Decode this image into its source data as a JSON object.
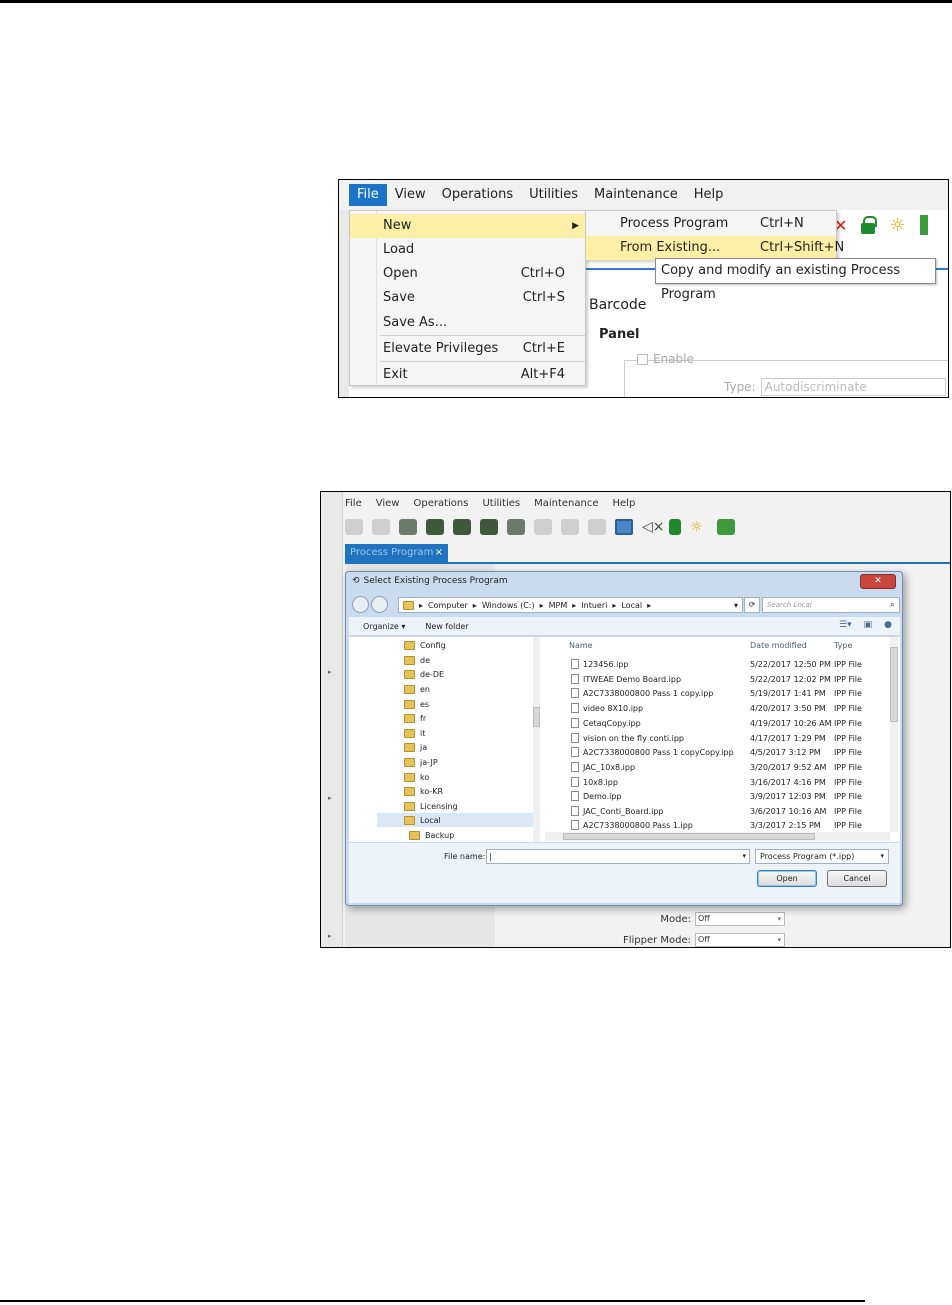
{
  "shot1": {
    "menubar": [
      "File",
      "View",
      "Operations",
      "Utilities",
      "Maintenance",
      "Help"
    ],
    "file_menu": {
      "items": [
        {
          "label": "New",
          "shortcut": ""
        },
        {
          "label": "Load",
          "shortcut": ""
        },
        {
          "label": "Open",
          "shortcut": "Ctrl+O"
        },
        {
          "label": "Save",
          "shortcut": "Ctrl+S"
        },
        {
          "label": "Save As...",
          "shortcut": ""
        },
        {
          "label": "Elevate Privileges",
          "shortcut": "Ctrl+E"
        },
        {
          "label": "Exit",
          "shortcut": "Alt+F4"
        }
      ]
    },
    "sub_menu": {
      "items": [
        {
          "label": "Process Program",
          "shortcut": "Ctrl+N"
        },
        {
          "label": "From Existing...",
          "shortcut": "Ctrl+Shift+N"
        }
      ]
    },
    "tooltip": "Copy and modify an existing Process Program",
    "background": {
      "barcode": "Barcode",
      "panel": "Panel",
      "enable": "Enable",
      "type_label": "Type:",
      "type_value": "Autodiscriminate"
    },
    "icons": [
      "close-red-icon",
      "lock-icon",
      "lightbulb-icon"
    ]
  },
  "shot2": {
    "menubar": [
      "File",
      "View",
      "Operations",
      "Utilities",
      "Maintenance",
      "Help"
    ],
    "tab_label": "Process Program",
    "tab_close": "×",
    "dialog": {
      "title": "Select Existing Process Program",
      "close": "✕",
      "breadcrumb": [
        "Computer",
        "Windows (C:)",
        "MPM",
        "Intueri",
        "Local"
      ],
      "search_placeholder": "Search Local",
      "organize": "Organize ▾",
      "new_folder": "New folder",
      "tree": [
        "Config",
        "de",
        "de-DE",
        "en",
        "es",
        "fr",
        "it",
        "ja",
        "ja-JP",
        "ko",
        "ko-KR",
        "Licensing",
        "Local",
        "Backup"
      ],
      "columns": {
        "name": "Name",
        "date": "Date modified",
        "type": "Type"
      },
      "files": [
        {
          "name": "123456.ipp",
          "date": "5/22/2017 12:50 PM",
          "type": "IPP File"
        },
        {
          "name": "ITWEAE Demo Board.ipp",
          "date": "5/22/2017 12:02 PM",
          "type": "IPP File"
        },
        {
          "name": "A2C7338000800 Pass 1 copy.ipp",
          "date": "5/19/2017 1:41 PM",
          "type": "IPP File"
        },
        {
          "name": "video 8X10.ipp",
          "date": "4/20/2017 3:50 PM",
          "type": "IPP File"
        },
        {
          "name": "CetaqCopy.ipp",
          "date": "4/19/2017 10:26 AM",
          "type": "IPP File"
        },
        {
          "name": "vision on the fly conti.ipp",
          "date": "4/17/2017 1:29 PM",
          "type": "IPP File"
        },
        {
          "name": "A2C7338000800 Pass 1 copyCopy.ipp",
          "date": "4/5/2017 3:12 PM",
          "type": "IPP File"
        },
        {
          "name": "JAC_10x8.ipp",
          "date": "3/20/2017 9:52 AM",
          "type": "IPP File"
        },
        {
          "name": "10x8.ipp",
          "date": "3/16/2017 4:16 PM",
          "type": "IPP File"
        },
        {
          "name": "Demo.ipp",
          "date": "3/9/2017 12:03 PM",
          "type": "IPP File"
        },
        {
          "name": "JAC_Conti_Board.ipp",
          "date": "3/6/2017 10:16 AM",
          "type": "IPP File"
        },
        {
          "name": "A2C7338000800 Pass 1.ipp",
          "date": "3/3/2017 2:15 PM",
          "type": "IPP File"
        }
      ],
      "filename_label": "File name:",
      "filename_value": "|",
      "filetype": "Process Program (*.ipp)",
      "open": "Open",
      "cancel": "Cancel"
    },
    "background": {
      "mode_label": "Mode:",
      "mode_value": "Off",
      "flipper_label": "Flipper Mode:",
      "flipper_value": "Off"
    }
  }
}
